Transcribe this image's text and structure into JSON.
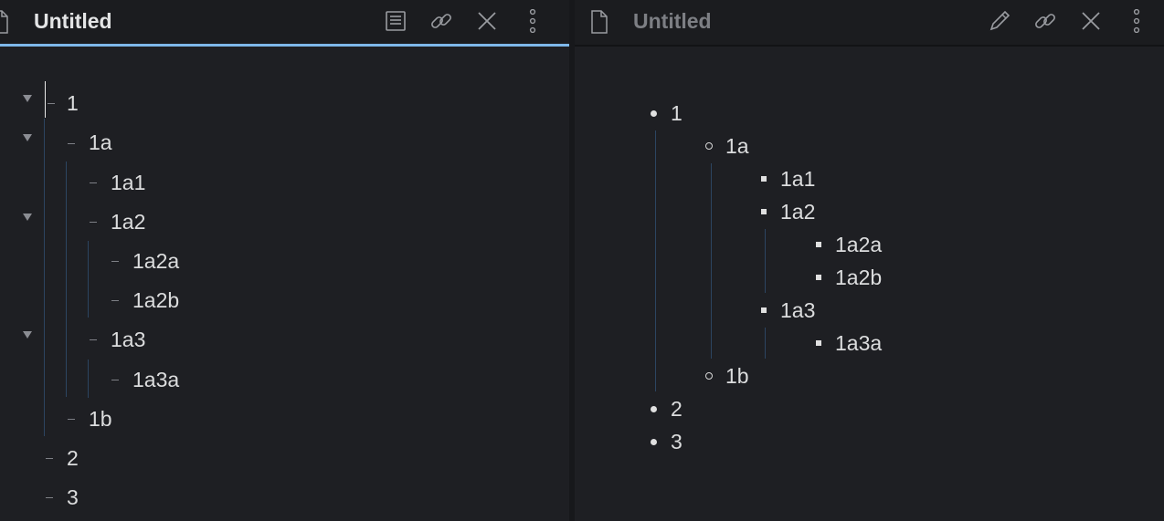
{
  "editor": {
    "title": "Untitled",
    "lines": [
      {
        "text": "1"
      },
      {
        "text": "1a"
      },
      {
        "text": "1a1"
      },
      {
        "text": "1a2"
      },
      {
        "text": "1a2a"
      },
      {
        "text": "1a2b"
      },
      {
        "text": "1a3"
      },
      {
        "text": "1a3a"
      },
      {
        "text": "1b"
      },
      {
        "text": "2"
      },
      {
        "text": "3"
      }
    ],
    "actions": [
      "reading-view-icon",
      "link-icon",
      "close-icon",
      "more-options-icon"
    ]
  },
  "preview": {
    "title": "Untitled",
    "items": [
      {
        "text": "1"
      },
      {
        "text": "1a"
      },
      {
        "text": "1a1"
      },
      {
        "text": "1a2"
      },
      {
        "text": "1a2a"
      },
      {
        "text": "1a2b"
      },
      {
        "text": "1a3"
      },
      {
        "text": "1a3a"
      },
      {
        "text": "1b"
      },
      {
        "text": "2"
      },
      {
        "text": "3"
      }
    ],
    "actions": [
      "edit-pencil-icon",
      "link-icon",
      "close-icon",
      "more-options-icon"
    ]
  },
  "colors": {
    "background": "#1e1f23",
    "header": "#1b1c1f",
    "active_underline": "#7fb8ea",
    "indent_guide": "#2c4561",
    "text": "#dcddde",
    "muted_title": "#7d7f84"
  }
}
